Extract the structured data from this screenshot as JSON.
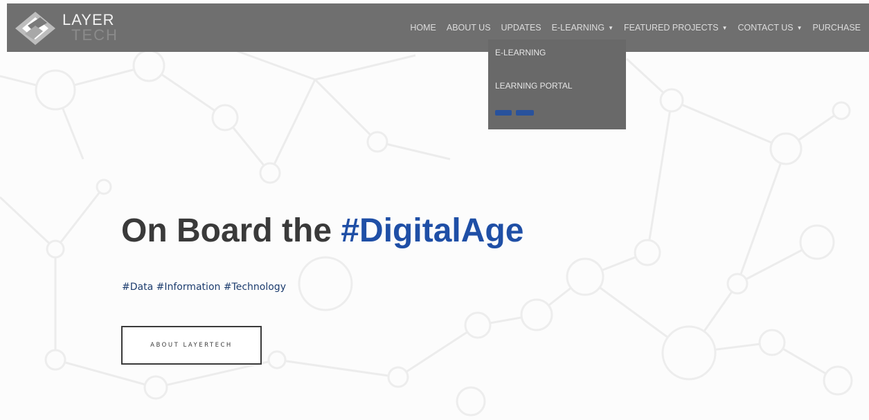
{
  "brand": {
    "logo_top": "LAYER",
    "logo_bottom": "TECH"
  },
  "nav": {
    "items": [
      {
        "label": "HOME",
        "has_dropdown": false
      },
      {
        "label": "ABOUT US",
        "has_dropdown": false
      },
      {
        "label": "UPDATES",
        "has_dropdown": false
      },
      {
        "label": "E-LEARNING",
        "has_dropdown": true
      },
      {
        "label": "FEATURED PROJECTS",
        "has_dropdown": true
      },
      {
        "label": "CONTACT US",
        "has_dropdown": true
      },
      {
        "label": "PURCHASE",
        "has_dropdown": false
      }
    ],
    "dropdown": {
      "items": [
        "E-LEARNING",
        "LEARNING PORTAL"
      ],
      "highlighted_item_color": "#1f4fa6"
    }
  },
  "hero": {
    "title_main": "On Board the",
    "title_accent": "#DigitalAge",
    "subtitle": "#Data #Information #Technology",
    "cta_label": "ABOUT LAYERTECH"
  },
  "colors": {
    "navbar": "#6f6f6f",
    "dropdown": "#696969",
    "accent": "#1f4fa6",
    "title": "#3a3a3a",
    "subtitle": "#1c3c6e"
  },
  "icons": {
    "caret": "caret-down-icon",
    "logo_mark": "layer-logo-icon"
  }
}
